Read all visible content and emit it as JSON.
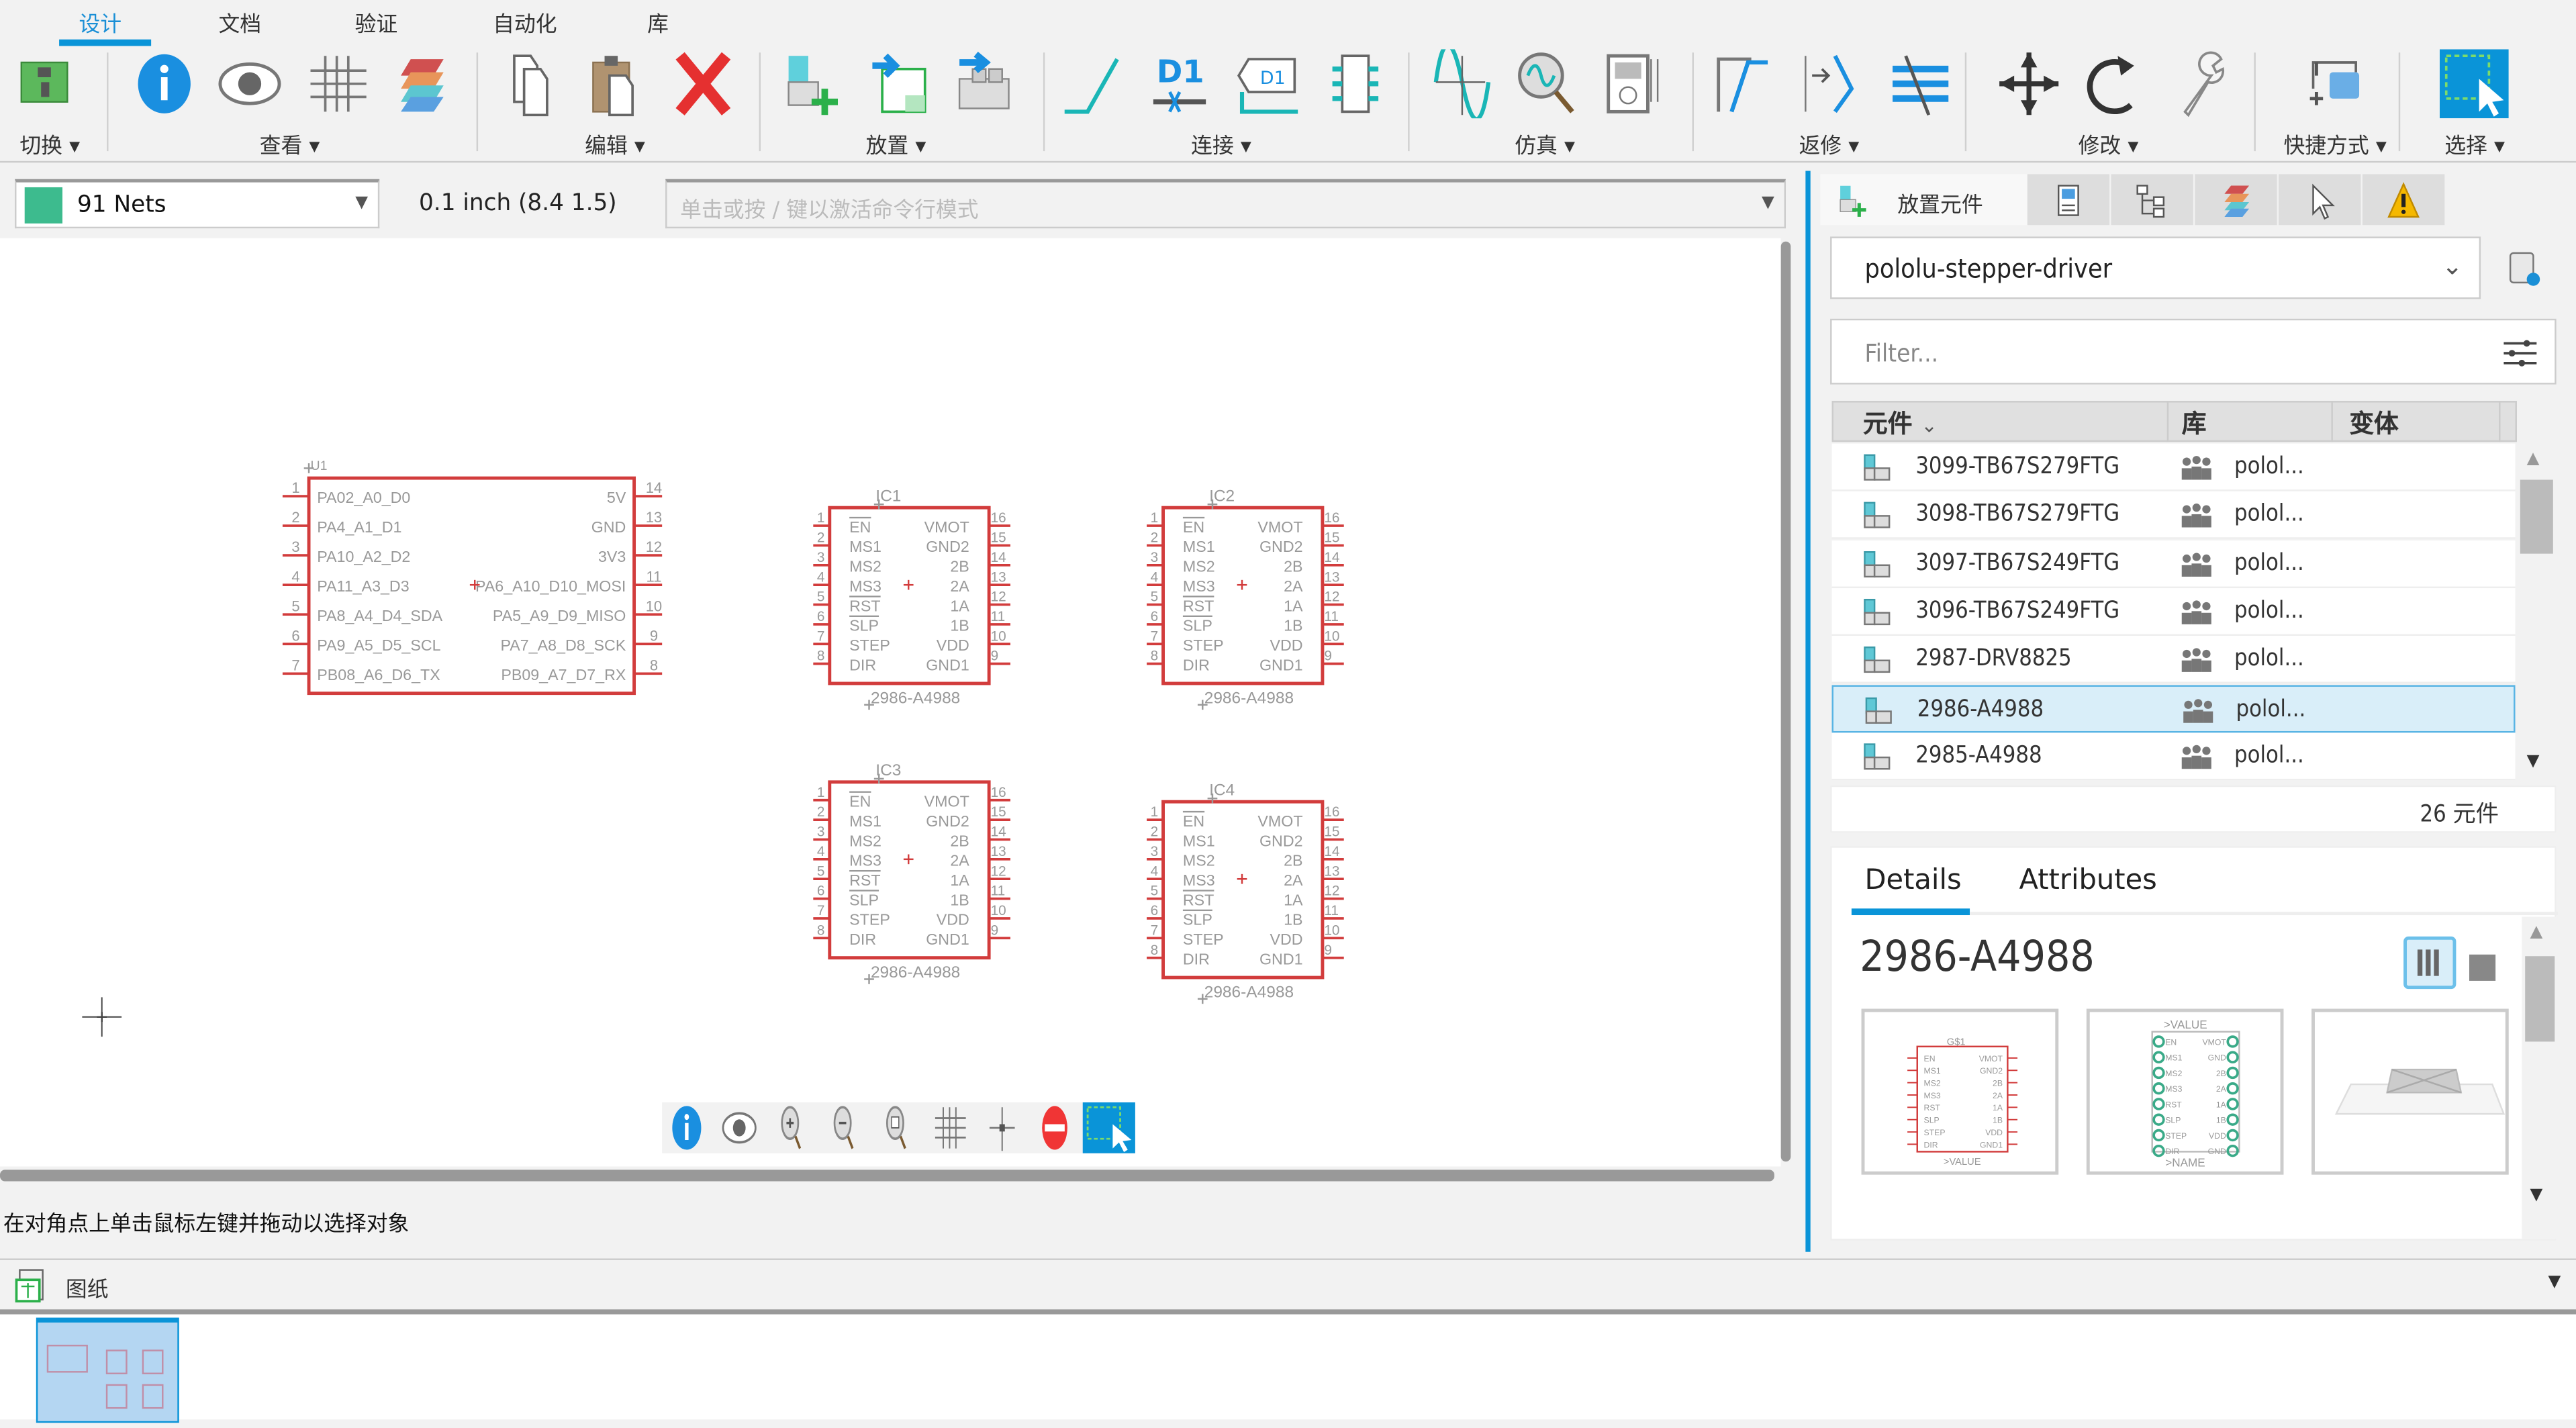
{
  "ribbon_tabs": [
    {
      "label": "设计",
      "active": true
    },
    {
      "label": "文档"
    },
    {
      "label": "验证"
    },
    {
      "label": "自动化"
    },
    {
      "label": "库"
    }
  ],
  "ribbon_groups": [
    {
      "label": "切换 ▾",
      "icons": [
        "board-switch-icon"
      ]
    },
    {
      "label": "查看 ▾",
      "icons": [
        "info-icon",
        "eye-icon",
        "grid-icon",
        "layers-icon"
      ]
    },
    {
      "label": "编辑 ▾",
      "icons": [
        "copy-icon",
        "paste-icon",
        "delete-icon"
      ]
    },
    {
      "label": "放置 ▾",
      "icons": [
        "add-part-icon",
        "place-sheet-icon",
        "place-module-icon"
      ]
    },
    {
      "label": "连接 ▾",
      "icons": [
        "net-icon",
        "name-icon",
        "label-icon",
        "bus-icon"
      ]
    },
    {
      "label": "仿真 ▾",
      "icons": [
        "simulate-icon",
        "probe-icon",
        "multimeter-icon"
      ]
    },
    {
      "label": "返修 ▾",
      "icons": [
        "miter-icon",
        "split-icon",
        "ripup-icon"
      ]
    },
    {
      "label": "修改 ▾",
      "icons": [
        "move-icon",
        "rotate-icon",
        "wrench-icon"
      ]
    },
    {
      "label": "快捷方式 ▾",
      "icons": [
        "shortcut-icon"
      ]
    },
    {
      "label": "选择 ▾",
      "icons": [
        "select-icon"
      ]
    }
  ],
  "toolbar": {
    "net_class": "91 Nets",
    "net_color": "#3dbb8e",
    "grid": "0.1 inch (8.4 1.5)",
    "command_placeholder": "单击或按 / 键以激活命令行模式"
  },
  "schematic": {
    "u1": {
      "name": "U1",
      "left_pins": [
        [
          "1",
          "PA02_A0_D0"
        ],
        [
          "2",
          "PA4_A1_D1"
        ],
        [
          "3",
          "PA10_A2_D2"
        ],
        [
          "4",
          "PA11_A3_D3"
        ],
        [
          "5",
          "PA8_A4_D4_SDA"
        ],
        [
          "6",
          "PA9_A5_D5_SCL"
        ],
        [
          "7",
          "PB08_A6_D6_TX"
        ]
      ],
      "right_pins": [
        [
          "14",
          "5V"
        ],
        [
          "13",
          "GND"
        ],
        [
          "12",
          "3V3"
        ],
        [
          "11",
          "PA6_A10_D10_MOSI"
        ],
        [
          "10",
          "PA5_A9_D9_MISO"
        ],
        [
          "9",
          "PA7_A8_D8_SCK"
        ],
        [
          "8",
          "PB09_A7_D7_RX"
        ]
      ]
    },
    "driver_left_pins": [
      [
        "1",
        "EN",
        true
      ],
      [
        "2",
        "MS1"
      ],
      [
        "3",
        "MS2"
      ],
      [
        "4",
        "MS3"
      ],
      [
        "5",
        "RST",
        true
      ],
      [
        "6",
        "SLP",
        true
      ],
      [
        "7",
        "STEP"
      ],
      [
        "8",
        "DIR"
      ]
    ],
    "driver_right_pins": [
      [
        "16",
        "VMOT"
      ],
      [
        "15",
        "GND2"
      ],
      [
        "14",
        "2B"
      ],
      [
        "13",
        "2A"
      ],
      [
        "12",
        "1A"
      ],
      [
        "11",
        "1B"
      ],
      [
        "10",
        "VDD"
      ],
      [
        "9",
        "GND1"
      ]
    ],
    "drivers": [
      {
        "name": "IC1",
        "value": "2986-A4988"
      },
      {
        "name": "IC2",
        "value": "2986-A4988"
      },
      {
        "name": "IC3",
        "value": "2986-A4988"
      },
      {
        "name": "IC4",
        "value": "2986-A4988"
      }
    ],
    "symbol_color": "#d23c3c"
  },
  "canvas_toolbar": [
    "info-icon",
    "eye-icon",
    "zoom-in-icon",
    "zoom-out-icon",
    "zoom-fit-icon",
    "grid-icon",
    "crosshair-icon",
    "stop-icon",
    "select-icon"
  ],
  "status": "在对角点上单击鼠标左键并拖动以选择对象",
  "sheets": {
    "label": "图纸"
  },
  "panel": {
    "tabs": [
      {
        "label": "放置元件",
        "active": true
      },
      {
        "icon": "properties-icon"
      },
      {
        "icon": "tree-icon"
      },
      {
        "icon": "layers-icon"
      },
      {
        "icon": "pointer-icon"
      },
      {
        "icon": "warning-icon"
      }
    ],
    "library": "pololu-stepper-driver",
    "filter_placeholder": "Filter...",
    "columns": [
      "元件",
      "库",
      "变体"
    ],
    "rows": [
      {
        "name": "3099-TB67S279FTG",
        "lib": "polol..."
      },
      {
        "name": "3098-TB67S279FTG",
        "lib": "polol..."
      },
      {
        "name": "3097-TB67S249FTG",
        "lib": "polol..."
      },
      {
        "name": "3096-TB67S249FTG",
        "lib": "polol..."
      },
      {
        "name": "2987-DRV8825",
        "lib": "polol..."
      },
      {
        "name": "2986-A4988",
        "lib": "polol...",
        "selected": true
      },
      {
        "name": "2985-A4988",
        "lib": "polol..."
      }
    ],
    "count": "26 元件",
    "detail_tabs": [
      {
        "label": "Details",
        "active": true
      },
      {
        "label": "Attributes"
      }
    ],
    "detail_title": "2986-A4988",
    "preview_symbol": {
      "gate": "G$1",
      "value": ">VALUE"
    },
    "preview_footprint": {
      "value": ">VALUE",
      "name": ">NAME",
      "pads": [
        "EN",
        "MS1",
        "MS2",
        "MS3",
        "RST",
        "SLP",
        "STEP",
        "DIR"
      ],
      "pads_right": [
        "VMOT",
        "GND",
        "2B",
        "2A",
        "1A",
        "1B",
        "VDD",
        "GND"
      ]
    }
  }
}
